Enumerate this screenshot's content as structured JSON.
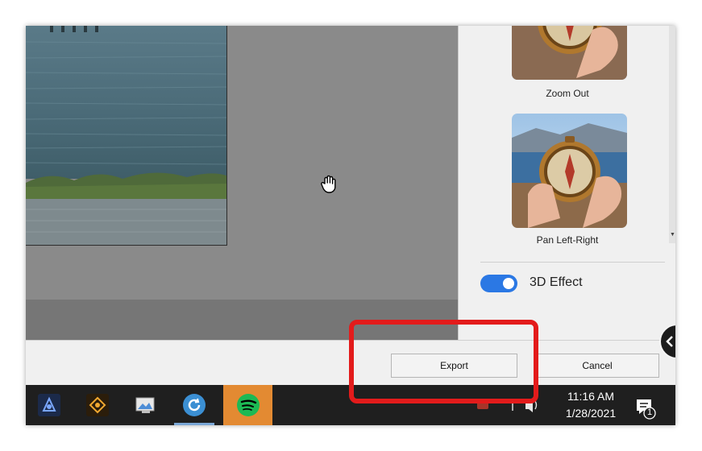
{
  "effects": {
    "items": [
      {
        "label": "Zoom Out"
      },
      {
        "label": "Pan Left-Right"
      }
    ]
  },
  "option": {
    "label": "3D Effect",
    "enabled": true
  },
  "buttons": {
    "export": "Export",
    "cancel": "Cancel"
  },
  "taskbar": {
    "apps": [
      "premiere-elements-icon",
      "photoshop-elements-icon",
      "photo-viewer-icon",
      "sync-icon",
      "spotify-icon"
    ],
    "time": "11:16 AM",
    "date": "1/28/2021",
    "notification_count": "1"
  },
  "colors": {
    "accent": "#2b78e4",
    "highlight": "#e31b1b",
    "spotify_tile": "#e38a32",
    "spotify_green": "#1db954"
  }
}
